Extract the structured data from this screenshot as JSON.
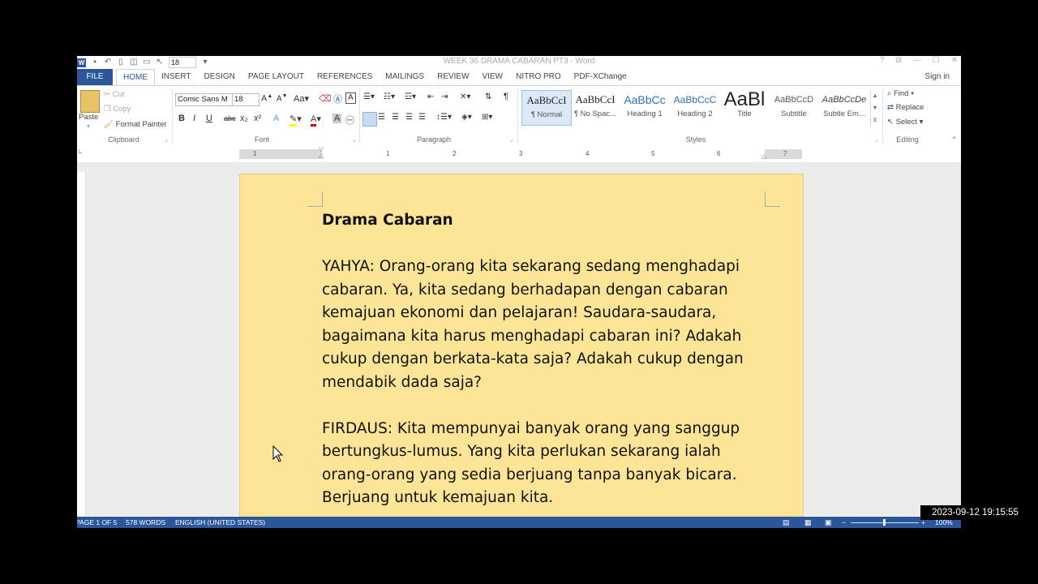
{
  "window": {
    "title": "WEEK 36 DRAMA CABARAN PT3 - Word",
    "qat_font_size": "18",
    "controls": [
      "?",
      "⧉",
      "—",
      "☐",
      "✕"
    ]
  },
  "tabs": {
    "file": "FILE",
    "items": [
      "HOME",
      "INSERT",
      "DESIGN",
      "PAGE LAYOUT",
      "REFERENCES",
      "MAILINGS",
      "REVIEW",
      "VIEW",
      "NITRO PRO",
      "PDF-XChange"
    ],
    "active": "HOME",
    "sign_in": "Sign in"
  },
  "clipboard": {
    "paste": "Paste",
    "cut": "Cut",
    "copy": "Copy",
    "format_painter": "Format Painter",
    "label": "Clipboard"
  },
  "font": {
    "name": "Comic Sans M",
    "size": "18",
    "label": "Font",
    "buttons": [
      "B",
      "I",
      "U",
      "abc",
      "x₂",
      "x²"
    ]
  },
  "paragraph": {
    "label": "Paragraph"
  },
  "styles": {
    "label": "Styles",
    "items": [
      {
        "preview": "AaBbCcI",
        "name": "¶ Normal"
      },
      {
        "preview": "AaBbCcI",
        "name": "¶ No Spac..."
      },
      {
        "preview": "AaBbCc",
        "name": "Heading 1"
      },
      {
        "preview": "AaBbCcC",
        "name": "Heading 2"
      },
      {
        "preview": "AaBl",
        "name": "Title"
      },
      {
        "preview": "AaBbCcD",
        "name": "Subtitle"
      },
      {
        "preview": "AaBbCcDe",
        "name": "Subtle Em..."
      }
    ],
    "accent": "#2b579a"
  },
  "editing": {
    "find": "Find",
    "replace": "Replace",
    "select": "Select",
    "label": "Editing"
  },
  "ruler": {
    "numbers": [
      "1",
      "1",
      "2",
      "3",
      "4",
      "5",
      "6",
      "7"
    ]
  },
  "document": {
    "heading": "Drama Cabaran",
    "paragraphs": [
      "YAHYA: Orang-orang kita sekarang sedang menghadapi cabaran. Ya, kita sedang berhadapan dengan cabaran kemajuan ekonomi dan pelajaran! Saudara-saudara, bagaimana kita harus menghadapi cabaran ini? Adakah cukup dengan berkata-kata saja? Adakah cukup dengan mendabik dada saja?",
      "FIRDAUS: Kita mempunyai banyak orang yang sanggup bertungkus-lumus. Yang kita perlukan sekarang ialah orang-orang yang sedia berjuang tanpa banyak bicara. Berjuang untuk kemajuan kita."
    ],
    "page_color": "#fde597"
  },
  "status": {
    "page": "PAGE 1 OF 5",
    "words": "578 WORDS",
    "language": "ENGLISH (UNITED STATES)",
    "zoom": "100%"
  },
  "timestamp": "2023-09-12 19:15:55"
}
